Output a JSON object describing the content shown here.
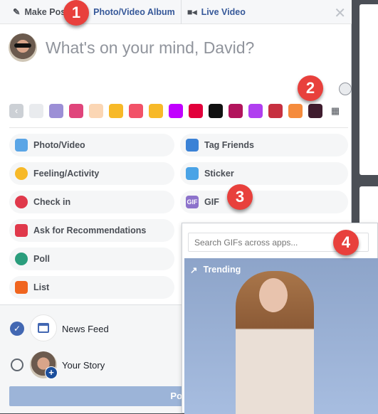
{
  "header": {
    "tabs": [
      {
        "label": "Make Post",
        "icon": "pencil-icon"
      },
      {
        "label": "Photo/Video Album",
        "icon": "album-icon"
      },
      {
        "label": "Live Video",
        "icon": "video-camera-icon"
      }
    ],
    "close_icon": "close-icon"
  },
  "composer": {
    "placeholder": "What's on your mind, David?"
  },
  "swatches": [
    "#e9ebee",
    "#9c8fd6",
    "#e0457b",
    "#fbd6b4",
    "#f7b928",
    "#f25268",
    "#f7b928",
    "#c100ff",
    "#e2003b",
    "#111111",
    "#b2145c",
    "#b03ff0",
    "#c73040",
    "#f58b3c",
    "#3f1c2e"
  ],
  "options": {
    "left": [
      {
        "label": "Photo/Video",
        "icon": "photo-icon",
        "color": "#5aa5e6"
      },
      {
        "label": "Feeling/Activity",
        "icon": "smiley-icon",
        "color": "#f7b928"
      },
      {
        "label": "Check in",
        "icon": "location-pin-icon",
        "color": "#e0394b"
      },
      {
        "label": "Ask for Recommendations",
        "icon": "recommendation-icon",
        "color": "#e0394b"
      },
      {
        "label": "Poll",
        "icon": "poll-icon",
        "color": "#2a9d7c"
      },
      {
        "label": "List",
        "icon": "list-icon",
        "color": "#f0651f"
      }
    ],
    "right": [
      {
        "label": "Tag Friends",
        "icon": "tag-friends-icon",
        "color": "#3b82d6"
      },
      {
        "label": "Sticker",
        "icon": "sticker-icon",
        "color": "#4aa3e6"
      },
      {
        "label": "GIF",
        "icon": "gif-icon",
        "color": "#8c72cb"
      }
    ]
  },
  "audience": {
    "news_feed": "News Feed",
    "your_story": "Your Story"
  },
  "post_button": "Post",
  "gif_picker": {
    "placeholder": "Search GIFs across apps...",
    "trending": "Trending"
  },
  "badges": [
    "1",
    "2",
    "3",
    "4"
  ]
}
